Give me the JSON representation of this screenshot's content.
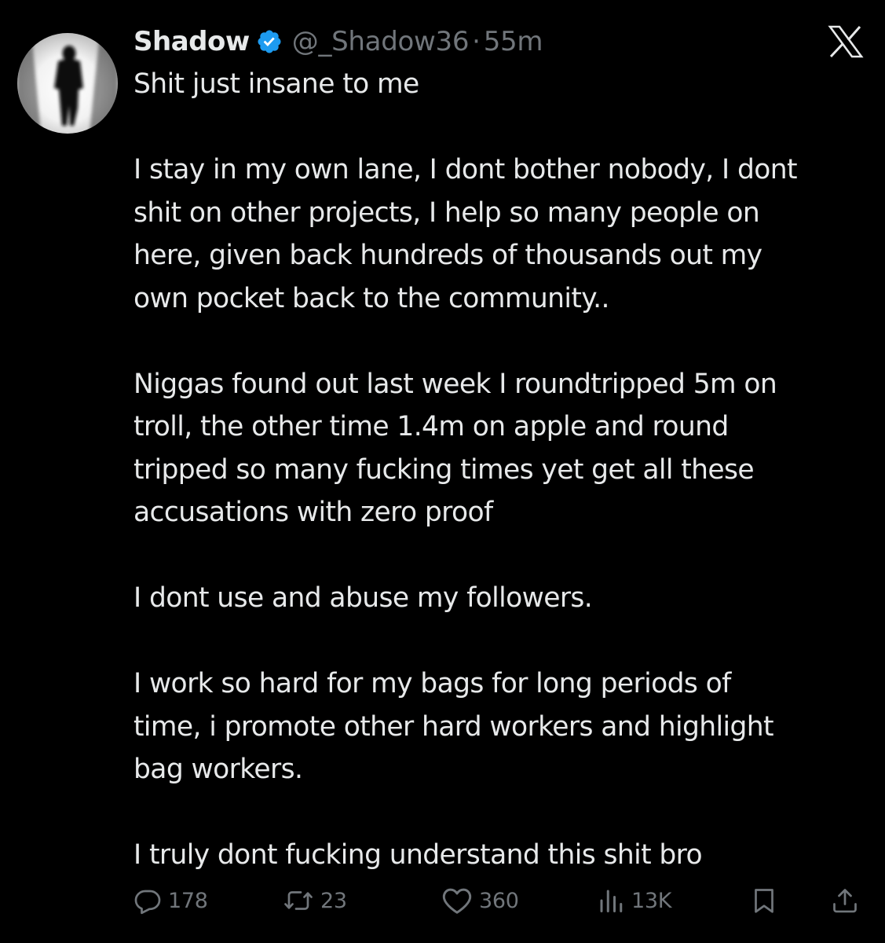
{
  "author": {
    "display_name": "Shadow",
    "handle": "@_Shadow36",
    "separator": "·",
    "time": "55m"
  },
  "paragraphs": [
    "Shit just insane to me",
    "I stay in my own lane, I dont bother nobody, I dont\nshit on other projects, I help so many people on\nhere, given back hundreds of thousands out my\nown pocket back to the community..",
    "Niggas found out last week I roundtripped 5m on\ntroll, the other time 1.4m on apple and round\ntripped so many fucking times yet get all these\naccusations with zero proof",
    "I dont use and abuse my followers.",
    "I work so hard for my bags for long periods of\ntime, i promote other hard workers and highlight\nbag workers.",
    "I truly dont fucking understand this shit bro"
  ],
  "actions": {
    "replies": "178",
    "reposts": "23",
    "likes": "360",
    "views": "13K"
  },
  "icons": {
    "verified": "verified-badge-icon",
    "brand": "x-logo-icon",
    "reply": "reply-icon",
    "repost": "repost-icon",
    "like": "heart-icon",
    "views": "views-icon",
    "bookmark": "bookmark-icon",
    "share": "share-icon"
  },
  "colors": {
    "background": "#000000",
    "text": "#e7e9ea",
    "secondary": "#71767b",
    "verified": "#1d9bf0"
  }
}
